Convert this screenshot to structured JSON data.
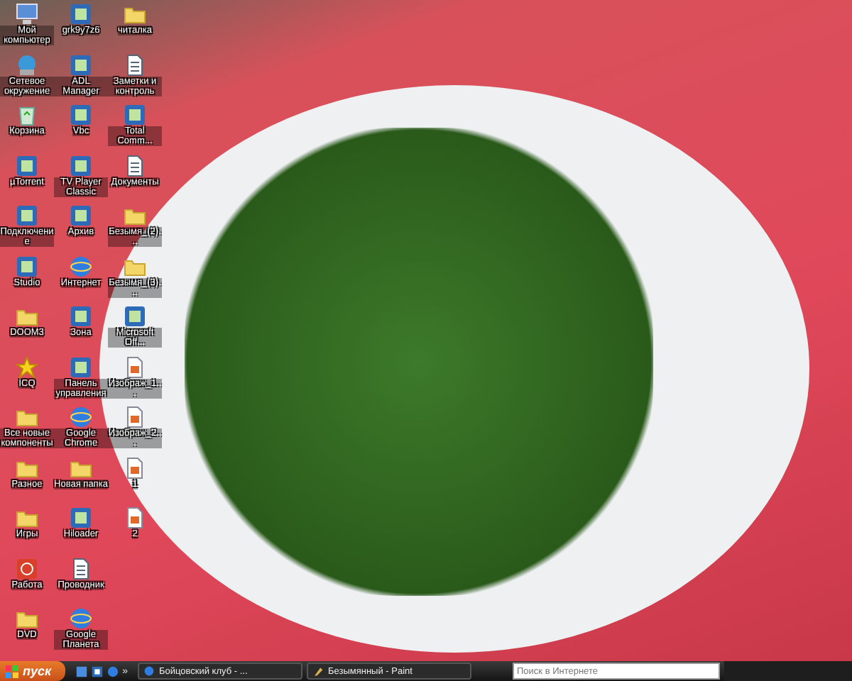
{
  "desktop": {
    "icons": [
      {
        "label": "Мой компьютер",
        "kind": "computer"
      },
      {
        "label": "Сетевое окружение",
        "kind": "network"
      },
      {
        "label": "Корзина",
        "kind": "trash"
      },
      {
        "label": "µTorrent",
        "kind": "app"
      },
      {
        "label": "Подключение",
        "kind": "app"
      },
      {
        "label": "Studio",
        "kind": "app"
      },
      {
        "label": "DOOM3",
        "kind": "folder"
      },
      {
        "label": "ICQ",
        "kind": "star"
      },
      {
        "label": "Все новые компоненты",
        "kind": "folder"
      },
      {
        "label": "Разное",
        "kind": "folder"
      },
      {
        "label": "Игры",
        "kind": "folder"
      },
      {
        "label": "Работа",
        "kind": "power"
      },
      {
        "label": "DVD",
        "kind": "folder"
      },
      {
        "label": "grk9y7z6",
        "kind": "app"
      },
      {
        "label": "ADL Manager",
        "kind": "app"
      },
      {
        "label": "Vbc",
        "kind": "app"
      },
      {
        "label": "TV Player Classic",
        "kind": "app"
      },
      {
        "label": "Архив",
        "kind": "app"
      },
      {
        "label": "Интернет",
        "kind": "globe"
      },
      {
        "label": "Зона",
        "kind": "app"
      },
      {
        "label": "Панель управления",
        "kind": "app"
      },
      {
        "label": "Google Chrome",
        "kind": "globe"
      },
      {
        "label": "Новая папка",
        "kind": "folder"
      },
      {
        "label": "Hiloader",
        "kind": "app"
      },
      {
        "label": "Проводник",
        "kind": "document"
      },
      {
        "label": "Google Планета",
        "kind": "globe"
      },
      {
        "label": "читалка",
        "kind": "folder"
      },
      {
        "label": "Заметки и контроль",
        "kind": "document"
      },
      {
        "label": "Total Comm...",
        "kind": "app"
      },
      {
        "label": "Документы",
        "kind": "document"
      },
      {
        "label": "Безымя_(2)...",
        "kind": "folder"
      },
      {
        "label": "Безымя_(3)...",
        "kind": "folder"
      },
      {
        "label": "Microsoft Off...",
        "kind": "app"
      },
      {
        "label": "Изображ_1...",
        "kind": "image"
      },
      {
        "label": "Изображ_2...",
        "kind": "image"
      },
      {
        "label": "1",
        "kind": "image"
      },
      {
        "label": "2",
        "kind": "image"
      }
    ]
  },
  "taskbar": {
    "start_label": "пуск",
    "more": "»",
    "tasks": [
      {
        "label": "Бойцовский клуб - ...",
        "selected": false
      },
      {
        "label": "Безымянный - Paint",
        "selected": false
      }
    ],
    "search": {
      "placeholder": "Поиск в Интернете"
    }
  }
}
